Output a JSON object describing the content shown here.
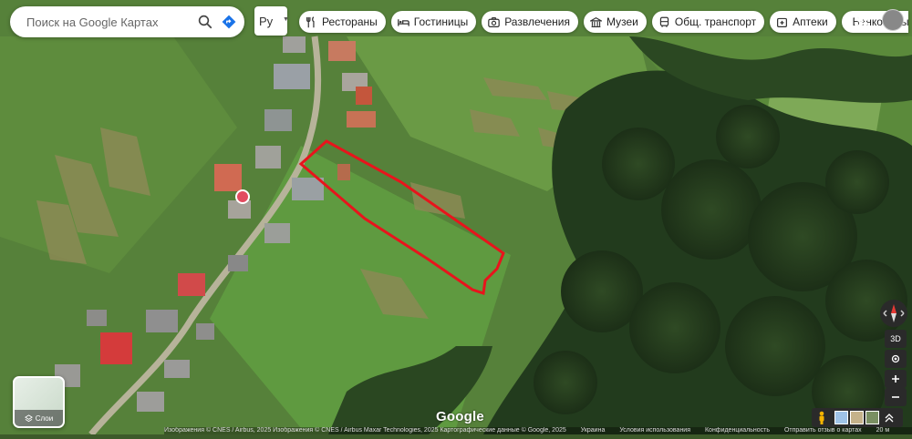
{
  "search": {
    "placeholder": "Поиск на Google Картах"
  },
  "language": {
    "label": "Ру"
  },
  "chips": [
    {
      "label": "Рестораны",
      "icon": "fork-knife-icon"
    },
    {
      "label": "Гостиницы",
      "icon": "bed-icon"
    },
    {
      "label": "Развлечения",
      "icon": "camera-icon"
    },
    {
      "label": "Музеи",
      "icon": "museum-icon"
    },
    {
      "label": "Общ. транспорт",
      "icon": "bus-icon"
    },
    {
      "label": "Аптеки",
      "icon": "pharmacy-icon"
    },
    {
      "label": "Банкоматы",
      "icon": "atm-icon"
    }
  ],
  "layers": {
    "label": "Слои"
  },
  "controls": {
    "tilt": "3D"
  },
  "brand": "Google",
  "footer": {
    "attribution": "Изображения © CNES / Airbus, 2025 Изображения © CNES / Airbus Maxar Technologies, 2025 Картографические данные © Google, 2025",
    "items": [
      "Украина",
      "Условия использования",
      "Конфиденциальность",
      "Отправить отзыв о картах",
      "20 м"
    ]
  },
  "colors": {
    "outline": "#e8141c",
    "chip_bg": "#ffffff"
  }
}
